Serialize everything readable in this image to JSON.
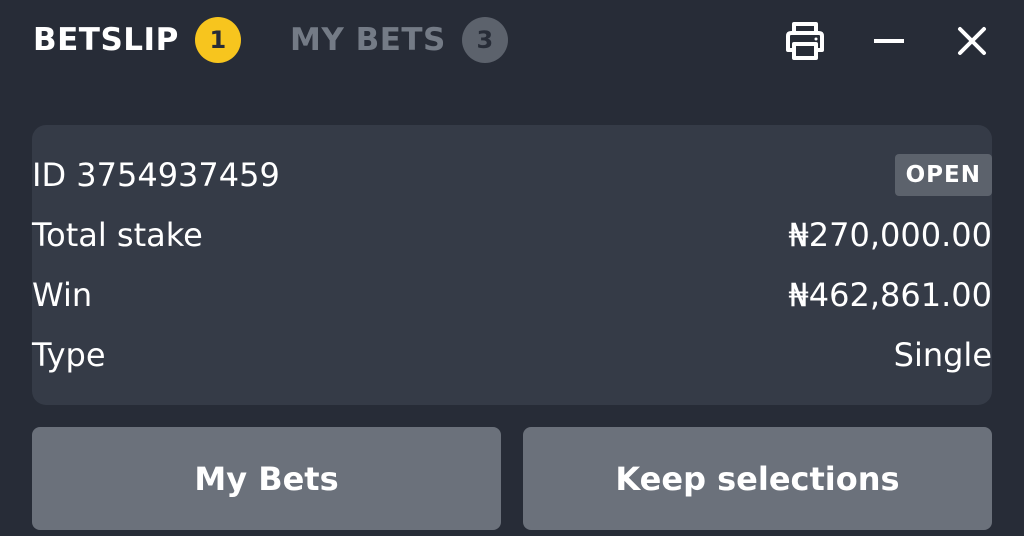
{
  "header": {
    "betslip_label": "BETSLIP",
    "betslip_count": "1",
    "mybets_label": "MY BETS",
    "mybets_count": "3",
    "icons": [
      "print-icon",
      "minimize-icon",
      "close-icon"
    ]
  },
  "bet": {
    "id_text": "ID 3754937459",
    "status": "OPEN",
    "rows": [
      {
        "label": "Total stake",
        "value": "₦270,000.00"
      },
      {
        "label": "Win",
        "value": "₦462,861.00"
      },
      {
        "label": "Type",
        "value": "Single"
      }
    ]
  },
  "actions": {
    "my_bets_label": "My Bets",
    "keep_selections_label": "Keep selections"
  },
  "colors": {
    "background": "#272c37",
    "card": "#353b47",
    "accent_badge": "#f7c51e",
    "inactive_badge": "#5c626c",
    "button": "#6b717b"
  }
}
